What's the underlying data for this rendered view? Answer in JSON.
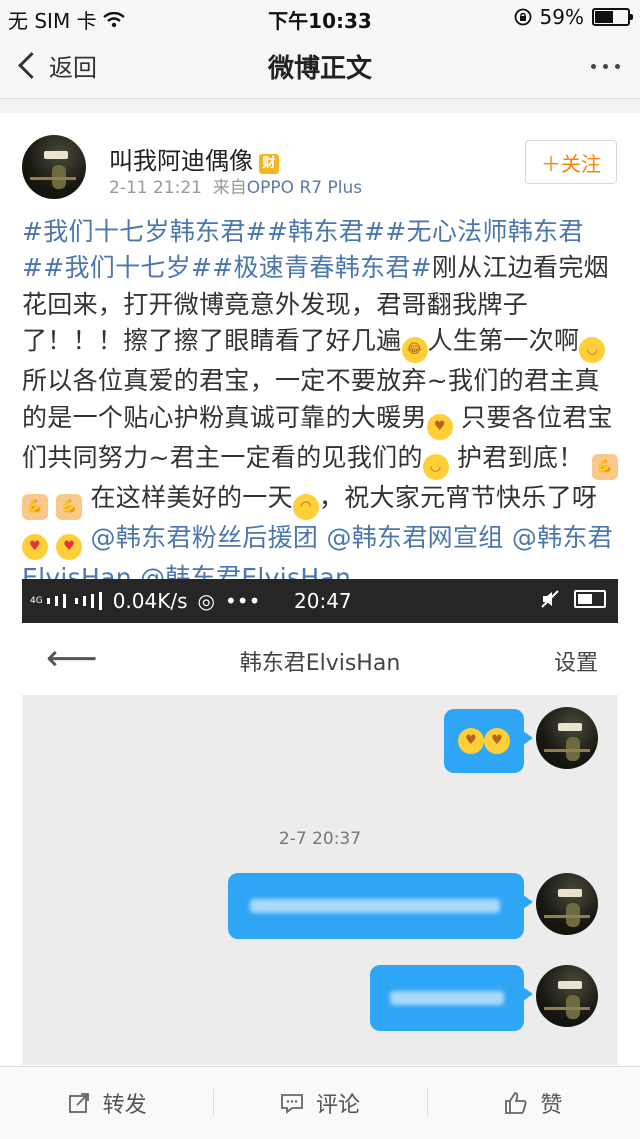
{
  "status_bar": {
    "carrier": "无 SIM 卡",
    "time": "下午10:33",
    "battery": "59%",
    "battery_level": 0.59
  },
  "nav": {
    "back_label": "返回",
    "title": "微博正文"
  },
  "post": {
    "username": "叫我阿迪偶像",
    "badge": "财",
    "date": "2-11 21:21",
    "source_prefix": "来自",
    "source": "OPPO R7 Plus",
    "follow_label": "＋关注",
    "tag1": "#我们十七岁韩东君#",
    "tag2": "#韩东君#",
    "tag3": "#无心法师韩东君#",
    "tag4": "#我们十七岁#",
    "tag5": "#极速青春韩东君#",
    "seg1": "刚从江边看完烟花回来，打开微博竟意外发现，君哥翻我牌子了！！！擦了擦了眼睛看了好几遍",
    "seg2": "人生第一次啊",
    "seg3": " 所以各位真爱的君宝，一定不要放弃~我们的君主真的是一个贴心护粉真诚可靠的大暖男",
    "seg4": " 只要各位君宝们共同努力~君主一定看的见我们的",
    "seg5": " 护君到底！",
    "seg6": " 在这样美好的一天",
    "seg7": "，祝大家元宵节快乐了呀",
    "mention1": "@韩东君粉丝后援团",
    "mention2": "@韩东君网宣组",
    "mention3": "@韩东君ElvisHan",
    "mention4": "@韩东君ElvisHan"
  },
  "screenshot": {
    "net_speed": "0.04K/s",
    "time": "20:47",
    "chat_title": "韩东君ElvisHan",
    "settings_label": "设置",
    "timestamp": "2-7 20:37"
  },
  "actions": {
    "repost": "转发",
    "comment": "评论",
    "like": "赞"
  },
  "icons": [
    "wifi-icon",
    "lock-rotation-icon",
    "battery-icon",
    "back-chevron-icon",
    "more-icon",
    "avatar",
    "back-arrow-icon",
    "mute-icon",
    "repost-icon",
    "comment-icon",
    "like-icon"
  ],
  "colors": {
    "link": "#4b77ae",
    "accent": "#ff8200",
    "bubble": "#2fa6f5"
  }
}
